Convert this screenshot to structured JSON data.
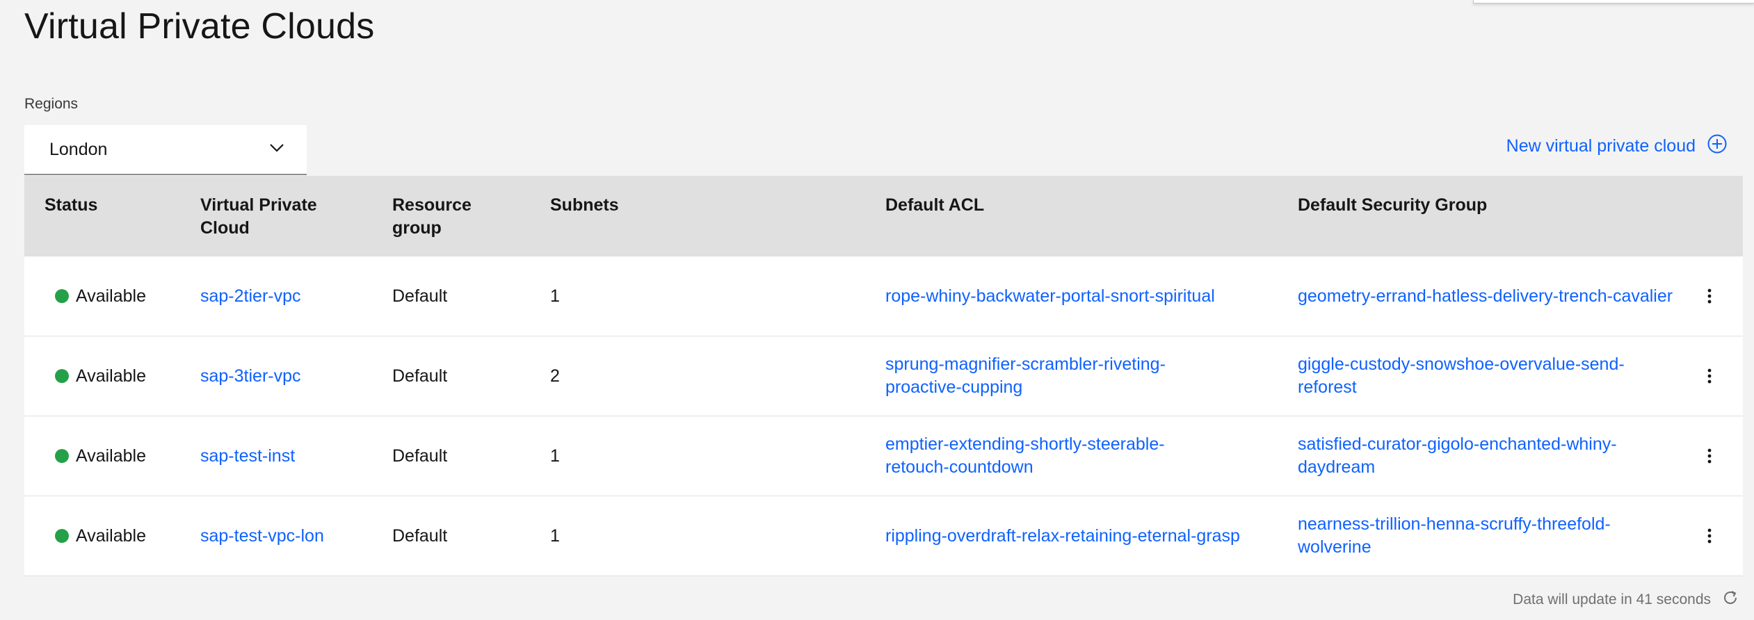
{
  "page": {
    "title": "Virtual Private Clouds"
  },
  "regions": {
    "label": "Regions",
    "selected": "London"
  },
  "actions": {
    "new_vpc_label": "New virtual private cloud"
  },
  "table": {
    "headers": {
      "status": "Status",
      "vpc": "Virtual Private Cloud",
      "resource_group": "Resource group",
      "subnets": "Subnets",
      "default_acl": "Default ACL",
      "default_sg": "Default Security Group"
    },
    "rows": [
      {
        "status": "Available",
        "vpc": "sap-2tier-vpc",
        "resource_group": "Default",
        "subnets": "1",
        "default_acl": "rope-whiny-backwater-portal-snort-spiritual",
        "default_sg": "geometry-errand-hatless-delivery-trench-cavalier"
      },
      {
        "status": "Available",
        "vpc": "sap-3tier-vpc",
        "resource_group": "Default",
        "subnets": "2",
        "default_acl": "sprung-magnifier-scrambler-riveting-proactive-cupping",
        "default_sg": "giggle-custody-snowshoe-overvalue-send-reforest"
      },
      {
        "status": "Available",
        "vpc": "sap-test-inst",
        "resource_group": "Default",
        "subnets": "1",
        "default_acl": "emptier-extending-shortly-steerable-retouch-countdown",
        "default_sg": "satisfied-curator-gigolo-enchanted-whiny-daydream"
      },
      {
        "status": "Available",
        "vpc": "sap-test-vpc-lon",
        "resource_group": "Default",
        "subnets": "1",
        "default_acl": "rippling-overdraft-relax-retaining-eternal-grasp",
        "default_sg": "nearness-trillion-henna-scruffy-threefold-wolverine"
      }
    ]
  },
  "footer": {
    "update_text": "Data will update in 41 seconds"
  },
  "colors": {
    "link": "#0f62fe",
    "available": "#24a148",
    "header_bg": "#e0e0e0",
    "page_bg": "#f3f3f3"
  }
}
